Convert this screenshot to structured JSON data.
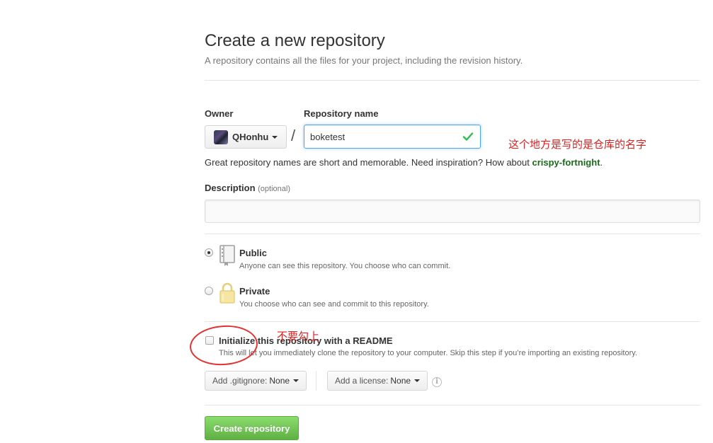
{
  "header": {
    "title": "Create a new repository",
    "subtitle": "A repository contains all the files for your project, including the revision history."
  },
  "owner": {
    "label": "Owner",
    "name": "QHonhu",
    "icon": "caret-down-icon"
  },
  "separator": "/",
  "repository": {
    "label": "Repository name",
    "value": "boketest",
    "valid_icon": "check-icon",
    "valid_color": "#2cbe4e"
  },
  "annotations": {
    "repo_name_note": "这个地方是写的是仓库的名字",
    "readme_note": "不要勾上",
    "color": "#e02020"
  },
  "hint": {
    "text": "Great repository names are short and memorable. Need inspiration? How about ",
    "suggestion": "crispy-fortnight",
    "end": "."
  },
  "description": {
    "label": "Description",
    "optional": "(optional)",
    "value": "",
    "placeholder": ""
  },
  "visibility": {
    "public": {
      "title": "Public",
      "desc": "Anyone can see this repository. You choose who can commit.",
      "icon": "repo-book-icon",
      "checked": true
    },
    "private": {
      "title": "Private",
      "desc": "You choose who can see and commit to this repository.",
      "icon": "lock-icon",
      "checked": false
    }
  },
  "readme": {
    "title": "Initialize this repository with a README",
    "desc": "This will let you immediately clone the repository to your computer. Skip this step if you’re importing an existing repository.",
    "checked": false
  },
  "gitignore": {
    "label": "Add .gitignore:",
    "value": "None"
  },
  "license": {
    "label": "Add a license:",
    "value": "None",
    "info_icon": "info-icon"
  },
  "submit": {
    "label": "Create repository",
    "color": "#60b044"
  }
}
